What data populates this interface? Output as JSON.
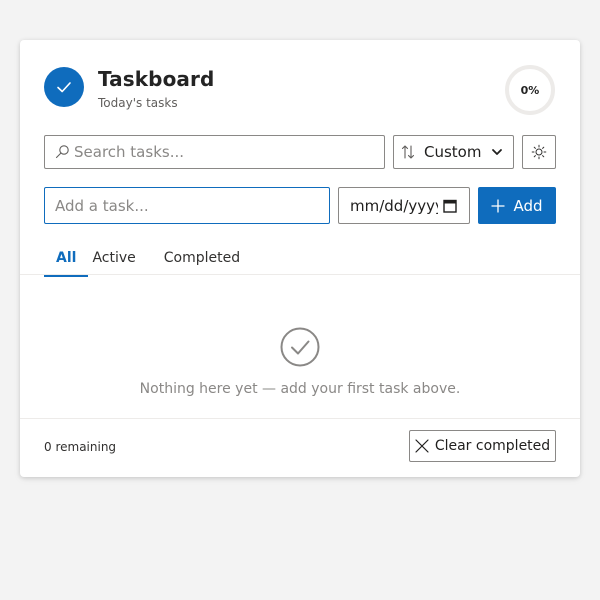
{
  "app": {
    "title": "Taskboard",
    "subtitle": "Today's tasks",
    "progress": 0,
    "progress_label": "0%",
    "logo_icon": "check-icon"
  },
  "toolbar": {
    "search_placeholder": "Search tasks...",
    "search_value": "",
    "sort_label": "Custom",
    "sort_icon": "sort-arrows-icon",
    "theme_icon": "sun-icon"
  },
  "add_row": {
    "task_placeholder": "Add a task...",
    "task_value": "",
    "date_placeholder": "mm/dd/yyyy",
    "add_label": "Add"
  },
  "tabs": [
    {
      "label": "All",
      "active": true
    },
    {
      "label": "Active",
      "active": false
    },
    {
      "label": "Completed",
      "active": false
    }
  ],
  "empty_state": {
    "icon": "check-circle-icon",
    "message": "Nothing here yet — add your first task above."
  },
  "footer": {
    "remaining": "0 remaining",
    "clear_label": "Clear completed"
  },
  "colors": {
    "accent": "#0f6cbd",
    "muted_text": "#8a8886"
  }
}
